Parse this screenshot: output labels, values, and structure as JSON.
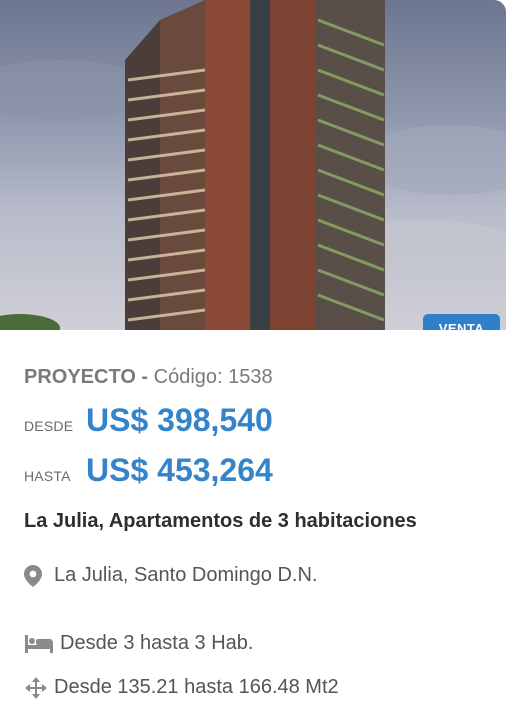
{
  "listing": {
    "badge": "VENTA",
    "type_label": "PROYECTO -",
    "code_text": "Código: 1538",
    "price_from_label": "DESDE",
    "price_from": "US$ 398,540",
    "price_to_label": "HASTA",
    "price_to": "US$ 453,264",
    "title": "La Julia, Apartamentos de 3 habitaciones",
    "location": "La Julia, Santo Domingo D.N.",
    "bedrooms": "Desde 3 hasta 3 Hab.",
    "area": "Desde 135.21 hasta 166.48 Mt2"
  },
  "icons": {
    "location": "map-marker-icon",
    "bedrooms": "bed-icon",
    "area": "move-arrows-icon"
  },
  "colors": {
    "accent": "#3583c8",
    "badge_bg": "#2f7fcb",
    "title": "#2e2e2e",
    "muted": "#7a7a7a"
  }
}
